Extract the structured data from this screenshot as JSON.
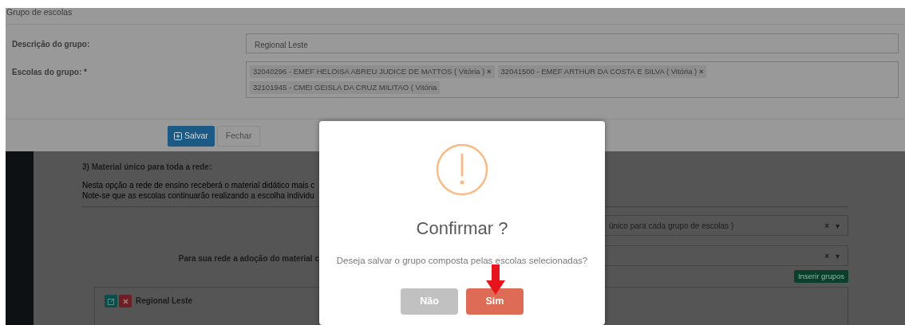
{
  "group_form": {
    "title": "Grupo de escolas",
    "description_label": "Descrição do grupo:",
    "description_value": "Regional Leste",
    "schools_label": "Escolas do grupo: *",
    "schools": [
      {
        "text": "32040296 - EMEF HELOISA ABREU JUDICE DE MATTOS ( Vitória )",
        "remove": "×"
      },
      {
        "text": "32041500 - EMEF ARTHUR DA COSTA E SILVA ( Vitória )",
        "remove": "×"
      },
      {
        "text": "32101945 - CMEI GEISLA DA CRUZ MILITAO ( Vitória"
      }
    ],
    "buttons": [
      {
        "label": "Salvar",
        "kind": "primary"
      },
      {
        "label": "Fechar",
        "kind": "secondary"
      }
    ]
  },
  "background_page": {
    "section_title": "3) Material único para toda a rede:",
    "paragraph_lines": [
      "Nesta opção a rede de ensino receberá o material didático mais c",
      "Note-se que as escolas continuarão realizando a escolha individu"
    ],
    "selects": [
      {
        "value": "único para cada grupo de escolas )",
        "clear": "×",
        "caret": "▾"
      },
      {
        "label": "Para sua rede a adoção do material c",
        "clear": "×",
        "caret": "▾"
      }
    ],
    "insert_button": "Inserir grupos",
    "group_card": {
      "title": "Regional Leste"
    }
  },
  "modal": {
    "title": "Confirmar ?",
    "text": "Deseja salvar o grupo composta pelas escolas selecionadas?",
    "buttons": [
      {
        "label": "Não",
        "kind": "cancel"
      },
      {
        "label": "Sim",
        "kind": "confirm"
      }
    ]
  }
}
